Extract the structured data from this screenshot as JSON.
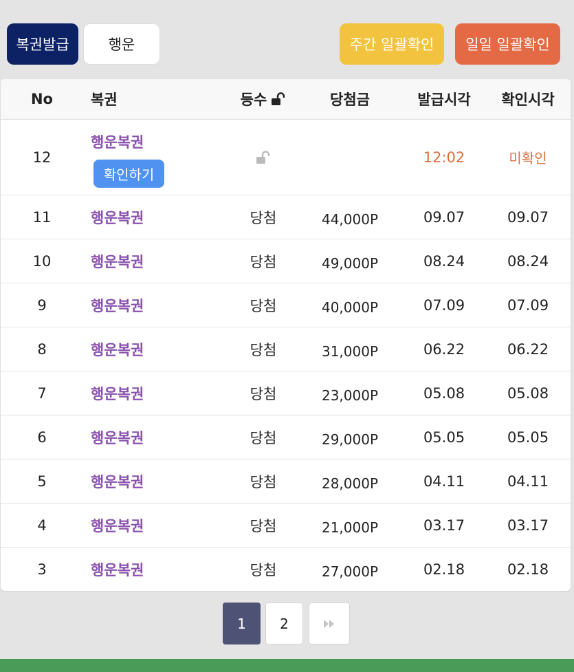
{
  "toolbar": {
    "issue_label": "복권발급",
    "luck_label": "행운",
    "weekly_label": "주간 일괄확인",
    "daily_label": "일일 일괄확인"
  },
  "table": {
    "headers": {
      "no": "No",
      "ticket": "복권",
      "rank": "등수",
      "prize": "당첨금",
      "issued": "발급시각",
      "checked": "확인시각"
    },
    "pending_row": {
      "no": "12",
      "ticket": "행운복권",
      "confirm_label": "확인하기",
      "issued": "12:02",
      "checked": "미확인"
    },
    "rows": [
      {
        "no": "11",
        "ticket": "행운복권",
        "rank": "당첨",
        "prize": "44,000P",
        "issued": "09.07",
        "checked": "09.07"
      },
      {
        "no": "10",
        "ticket": "행운복권",
        "rank": "당첨",
        "prize": "49,000P",
        "issued": "08.24",
        "checked": "08.24"
      },
      {
        "no": "9",
        "ticket": "행운복권",
        "rank": "당첨",
        "prize": "40,000P",
        "issued": "07.09",
        "checked": "07.09"
      },
      {
        "no": "8",
        "ticket": "행운복권",
        "rank": "당첨",
        "prize": "31,000P",
        "issued": "06.22",
        "checked": "06.22"
      },
      {
        "no": "7",
        "ticket": "행운복권",
        "rank": "당첨",
        "prize": "23,000P",
        "issued": "05.08",
        "checked": "05.08"
      },
      {
        "no": "6",
        "ticket": "행운복권",
        "rank": "당첨",
        "prize": "29,000P",
        "issued": "05.05",
        "checked": "05.05"
      },
      {
        "no": "5",
        "ticket": "행운복권",
        "rank": "당첨",
        "prize": "28,000P",
        "issued": "04.11",
        "checked": "04.11"
      },
      {
        "no": "4",
        "ticket": "행운복권",
        "rank": "당첨",
        "prize": "21,000P",
        "issued": "03.17",
        "checked": "03.17"
      },
      {
        "no": "3",
        "ticket": "행운복권",
        "rank": "당첨",
        "prize": "27,000P",
        "issued": "02.18",
        "checked": "02.18"
      }
    ]
  },
  "pagination": {
    "pages": [
      "1",
      "2"
    ],
    "current": "1",
    "next_icon": "double-chevron-right-icon"
  },
  "colors": {
    "issue_button": "#0d2265",
    "weekly_button": "#f2c33f",
    "daily_button": "#e36a45",
    "ticket_name": "#8a52ad",
    "confirm_button": "#4f92f0",
    "pending_time": "#d97040",
    "current_page": "#4e5275",
    "bottom_bar": "#4a9a58"
  }
}
